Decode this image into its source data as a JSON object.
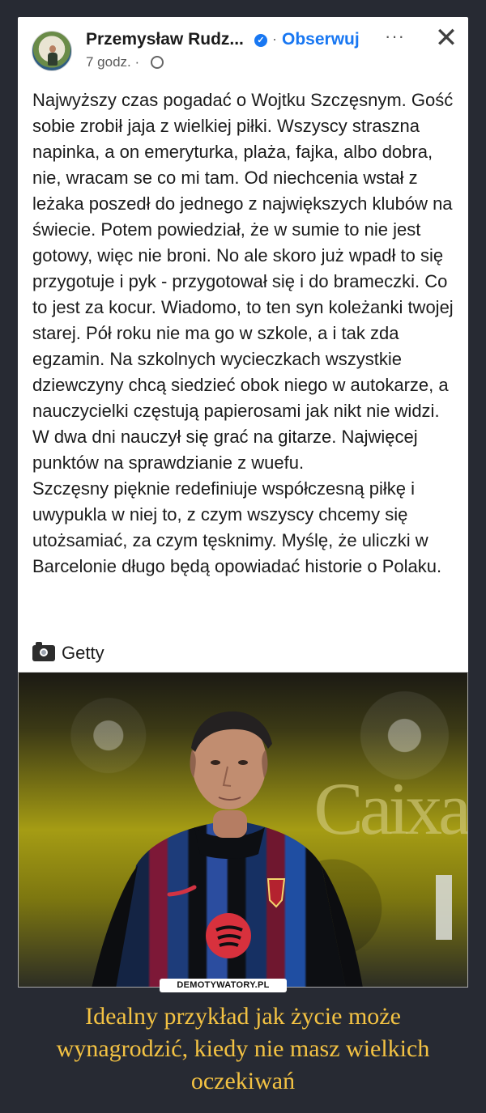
{
  "post": {
    "author": "Przemysław Rudz...",
    "verified_icon": "check-icon",
    "separator": "·",
    "follow_label": "Obserwuj",
    "time": "7 godz. ·",
    "more_label": "···",
    "close_label": "✕",
    "body": "Najwyższy czas pogadać o Wojtku Szczęsnym. Gość sobie zrobił jaja z wielkiej piłki. Wszyscy straszna napinka, a on emeryturka, plaża, fajka, albo dobra, nie, wracam se co mi tam. Od niechcenia wstał z leżaka poszedł do jednego z największych klubów na świecie. Potem powiedział, że w sumie to nie jest gotowy, więc nie broni. No ale skoro już wpadł to się przygotuje i pyk - przygotował się i do brameczki. Co to jest za kocur. Wiadomo, to ten syn koleżanki twojej starej. Pół roku nie ma go w szkole, a i tak zda egzamin. Na szkolnych wycieczkach wszystkie dziewczyny chcą siedzieć obok niego w autokarze, a nauczycielki częstują papierosami jak nikt nie widzi. W dwa dni nauczył się grać na gitarze. Najwięcej punktów na sprawdzianie z wuefu.\nSzczęsny pięknie redefiniuje współczesną piłkę i uwypukla w niej to, z czym wszyscy chcemy się utożsamiać, za czym tęsknimy. Myślę, że uliczki w Barcelonie długo będą opowiadać historie o Polaku.",
    "credit": "Getty"
  },
  "photo": {
    "background_text": "Caixa",
    "watermark": "DEMOTYWATORY.PL"
  },
  "caption": "Idealny przykład jak życie może wynagrodzić, kiedy nie masz wielkich oczekiwań"
}
